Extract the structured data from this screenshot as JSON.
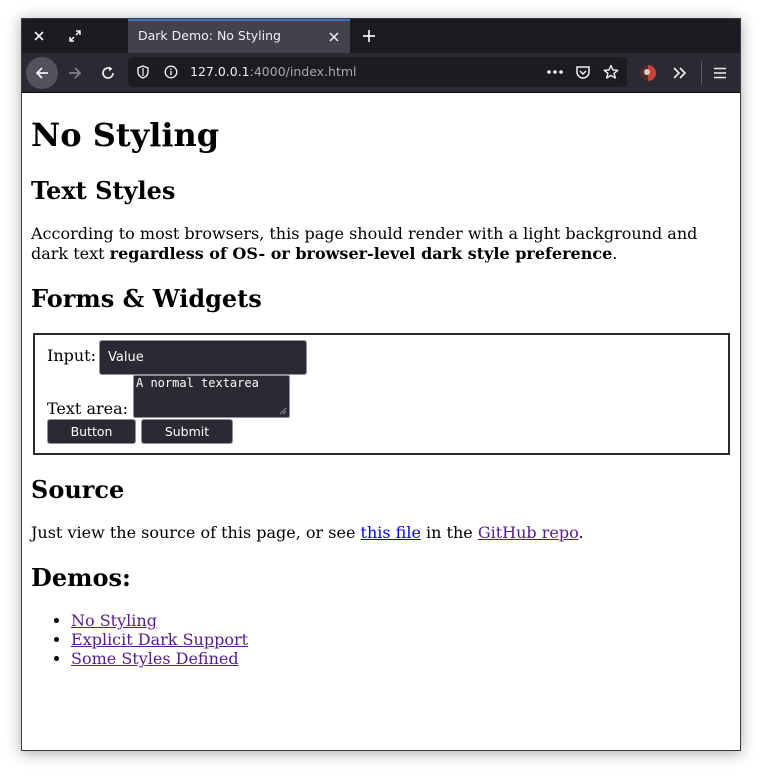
{
  "browser": {
    "tab_title": "Dark Demo: No Styling",
    "url_host": "127.0.0.1",
    "url_path": ":4000/index.html"
  },
  "page": {
    "title": "No Styling",
    "text_styles_heading": "Text Styles",
    "intro_text": "According to most browsers, this page should render with a light background and dark text ",
    "intro_bold": "regardless of OS- or browser-level dark style preference",
    "intro_end": ".",
    "forms_heading": "Forms & Widgets",
    "input_label": "Input:",
    "input_value": "Value",
    "textarea_label": "Text area:",
    "textarea_value": "A normal textarea",
    "button_label": "Button",
    "submit_label": "Submit",
    "source_heading": "Source",
    "source_text_before": "Just view the source of this page, or see ",
    "source_link1": "this file",
    "source_text_middle": " in the ",
    "source_link2": "GitHub repo",
    "source_text_end": ".",
    "demos_heading": "Demos:",
    "demos": [
      {
        "label": "No Styling"
      },
      {
        "label": "Explicit Dark Support"
      },
      {
        "label": "Some Styles Defined"
      }
    ]
  },
  "colors": {
    "tab_accent": "#3b72c4",
    "link": "#0000ee",
    "visited_link": "#551a8b",
    "widget_bg": "#2b2a33"
  },
  "icons": [
    "close-window-icon",
    "maximize-icon",
    "tab-close-icon",
    "new-tab-icon",
    "back-arrow-icon",
    "forward-arrow-icon",
    "reload-icon",
    "shield-icon",
    "info-icon",
    "more-actions-icon",
    "pocket-icon",
    "bookmark-star-icon",
    "extension-avatar-icon",
    "overflow-chevrons-icon",
    "hamburger-menu-icon"
  ]
}
